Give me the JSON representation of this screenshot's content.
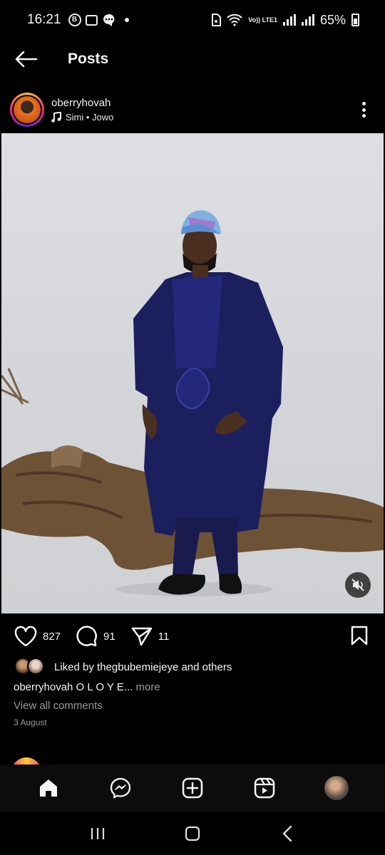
{
  "status_bar": {
    "time": "16:21",
    "battery": "65%",
    "network_label": "Vo)) LTE1",
    "icons": [
      "b-circle-icon",
      "gallery-icon",
      "chat-icon",
      "dot-icon",
      "sim-icon",
      "wifi-icon",
      "signal-icon",
      "signal-icon",
      "battery-icon"
    ]
  },
  "app_bar": {
    "title": "Posts"
  },
  "post": {
    "username": "oberryhovah",
    "song": "Simi • Jowo",
    "likes_count": "827",
    "comments_count": "91",
    "shares_count": "11",
    "liked_by": "Liked by thegbubemiejeye and others",
    "caption_user": "oberryhovah",
    "caption_text": " O L O Y E...",
    "caption_more": " more",
    "view_comments": "View all comments",
    "date": "3 August"
  },
  "bottom_nav": {
    "items": [
      "home-icon",
      "messenger-icon",
      "create-icon",
      "reels-icon",
      "profile-avatar"
    ]
  },
  "colors": {
    "background": "#000000",
    "text": "#f5f5f5",
    "muted": "#9a9a9a",
    "garment": "#1c1f5e",
    "wood": "#6e5236"
  }
}
